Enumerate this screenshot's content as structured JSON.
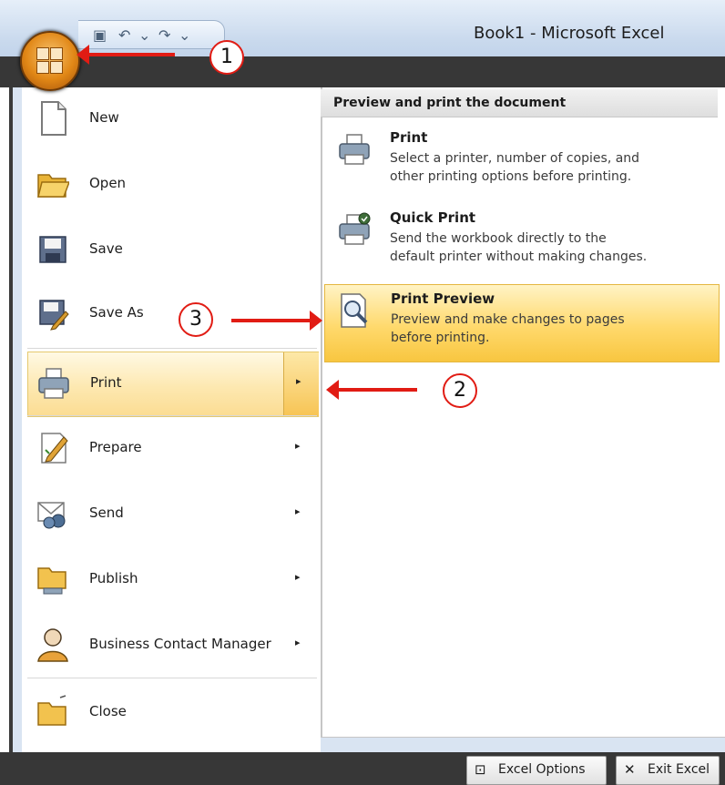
{
  "window": {
    "title": "Book1 - Microsoft Excel"
  },
  "quick_access_toolbar": {
    "items": [
      {
        "icon": "save-icon",
        "glyph": "▣"
      },
      {
        "icon": "undo-icon",
        "glyph": "↶"
      },
      {
        "icon": "dropdown-icon",
        "glyph": "⌄"
      },
      {
        "icon": "redo-icon",
        "glyph": "↷"
      },
      {
        "icon": "dropdown-icon",
        "glyph": "⌄"
      }
    ]
  },
  "office_menu": {
    "items": [
      {
        "label": "New",
        "icon": "new-document-icon",
        "has_submenu": false
      },
      {
        "label": "Open",
        "icon": "open-folder-icon",
        "has_submenu": false
      },
      {
        "label": "Save",
        "icon": "save-disk-icon",
        "has_submenu": false
      },
      {
        "label": "Save As",
        "icon": "save-as-icon",
        "has_submenu": false
      },
      {
        "label": "Print",
        "icon": "printer-icon",
        "has_submenu": true,
        "selected": true
      },
      {
        "label": "Prepare",
        "icon": "prepare-icon",
        "has_submenu": true
      },
      {
        "label": "Send",
        "icon": "send-icon",
        "has_submenu": true
      },
      {
        "label": "Publish",
        "icon": "publish-icon",
        "has_submenu": true
      },
      {
        "label": "Business Contact Manager",
        "icon": "contact-manager-icon",
        "has_submenu": true
      },
      {
        "label": "Close",
        "icon": "close-folder-icon",
        "has_submenu": false
      }
    ],
    "submenu_arrow": "▸"
  },
  "print_submenu": {
    "header": "Preview and print the document",
    "items": [
      {
        "title": "Print",
        "desc1": "Select a printer, number of copies, and",
        "desc2": "other printing options before printing.",
        "icon": "printer-icon"
      },
      {
        "title": "Quick Print",
        "desc1": "Send the workbook directly to the",
        "desc2": "default printer without making changes.",
        "icon": "quick-print-icon"
      },
      {
        "title": "Print Preview",
        "desc1": "Preview and make changes to pages",
        "desc2": "before printing.",
        "icon": "print-preview-icon",
        "selected": true
      }
    ]
  },
  "footer": {
    "options_label": "Excel Options",
    "exit_label": "Exit Excel"
  },
  "annotations": [
    "1",
    "2",
    "3"
  ],
  "colors": {
    "accent_orange": "#e18716",
    "highlight_yellow": "#ffd96c",
    "annotation_red": "#e11c14",
    "dark_frame": "#373737"
  }
}
